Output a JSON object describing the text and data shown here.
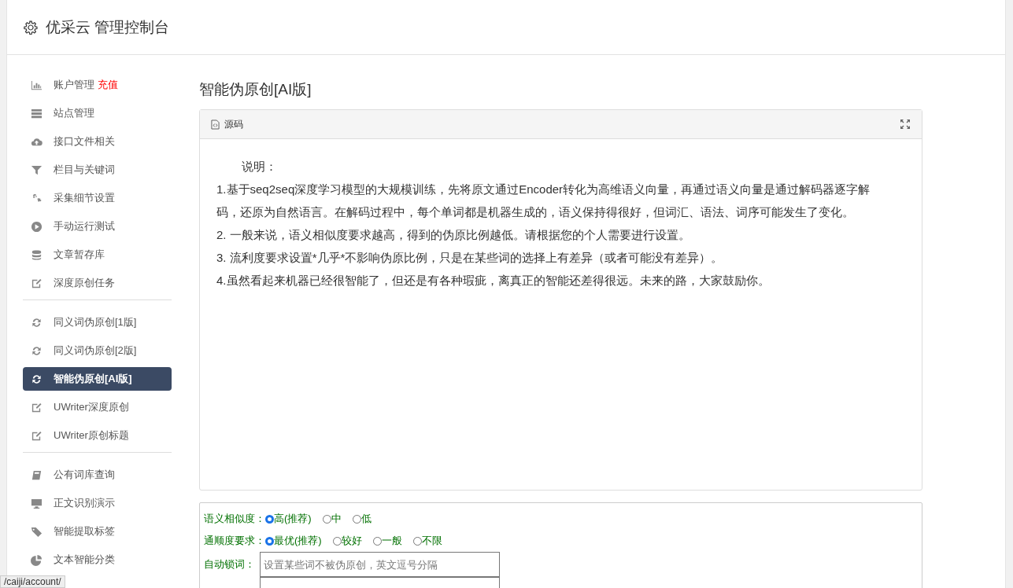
{
  "header": {
    "title": "优采云 管理控制台"
  },
  "sidebar": {
    "groups": [
      {
        "items": [
          {
            "label": "账户管理",
            "badge": "充值",
            "selected": false
          },
          {
            "label": "站点管理",
            "selected": false
          },
          {
            "label": "接口文件相关",
            "selected": false
          },
          {
            "label": "栏目与关键词",
            "selected": false
          },
          {
            "label": "采集细节设置",
            "selected": false
          },
          {
            "label": "手动运行测试",
            "selected": false
          },
          {
            "label": "文章暂存库",
            "selected": false
          },
          {
            "label": "深度原创任务",
            "selected": false
          }
        ]
      },
      {
        "items": [
          {
            "label": "同义词伪原创[1版]",
            "selected": false
          },
          {
            "label": "同义词伪原创[2版]",
            "selected": false
          },
          {
            "label": "智能伪原创[AI版]",
            "selected": true
          },
          {
            "label": "UWriter深度原创",
            "selected": false
          },
          {
            "label": "UWriter原创标题",
            "selected": false
          }
        ]
      },
      {
        "items": [
          {
            "label": "公有词库查询",
            "selected": false
          },
          {
            "label": "正文识别演示",
            "selected": false
          },
          {
            "label": "智能提取标签",
            "selected": false
          },
          {
            "label": "文本智能分类",
            "selected": false
          }
        ]
      }
    ]
  },
  "content": {
    "title": "智能伪原创[AI版]",
    "editor": {
      "toolbar_label": "源码",
      "paragraphs": [
        "说明：",
        "1.基于seq2seq深度学习模型的大规模训练，先将原文通过Encoder转化为高维语义向量，再通过语义向量是通过解码器逐字解码，还原为自然语言。在解码过程中，每个单词都是机器生成的，语义保持得很好，但词汇、语法、词序可能发生了变化。",
        "2. 一般来说，语义相似度要求越高，得到的伪原比例越低。请根据您的个人需要进行设置。",
        "3. 流利度要求设置*几乎*不影响伪原比例，只是在某些词的选择上有差异（或者可能没有差异）。",
        "4.虽然看起来机器已经很智能了，但还是有各种瑕疵，离真正的智能还差得很远。未来的路，大家鼓励你。"
      ]
    },
    "form": {
      "rows": [
        {
          "kind": "radio",
          "label": "语义相似度：",
          "options": [
            {
              "label": "高(推荐)",
              "selected": true
            },
            {
              "label": "中",
              "selected": false
            },
            {
              "label": "低",
              "selected": false
            }
          ]
        },
        {
          "kind": "radio",
          "label": "通顺度要求：",
          "options": [
            {
              "label": "最优(推荐)",
              "selected": true
            },
            {
              "label": "较好",
              "selected": false
            },
            {
              "label": "一般",
              "selected": false
            },
            {
              "label": "不限",
              "selected": false
            }
          ]
        },
        {
          "kind": "input",
          "label": "自动锁词：",
          "placeholder": "设置某些词不被伪原创，英文逗号分隔"
        },
        {
          "kind": "input"
        }
      ]
    }
  },
  "status_bar": {
    "url": "/caiji/account/"
  }
}
